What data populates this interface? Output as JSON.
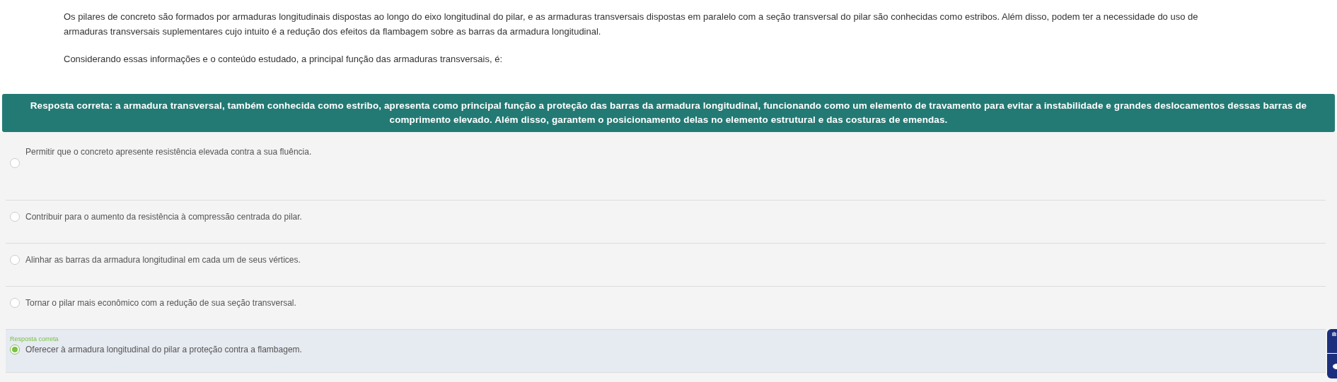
{
  "question": {
    "paragraphs": [
      "Os pilares de concreto são formados por armaduras longitudinais dispostas ao longo do eixo longitudinal do pilar, e as armaduras transversais dispostas em paralelo com a seção transversal do pilar são conhecidas como estribos. Além disso, podem ter a necessidade do uso de armaduras transversais suplementares cujo intuito é a redução dos efeitos da flambagem sobre as barras da armadura longitudinal.",
      "Considerando essas informações e o conteúdo estudado, a principal função das armaduras transversais, é:"
    ]
  },
  "feedback": "Resposta correta: a armadura transversal, também conhecida como estribo, apresenta como principal função a proteção das barras da armadura longitudinal, funcionando como um elemento de travamento para evitar a instabilidade e grandes deslocamentos dessas barras de comprimento elevado. Além disso, garantem o posicionamento delas no elemento estrutural e das costuras de emendas.",
  "options": [
    {
      "text": "Permitir que o concreto apresente resistência elevada contra a sua fluência.",
      "selected": false
    },
    {
      "text": "Contribuir para o aumento da resistência à compressão centrada do pilar.",
      "selected": false
    },
    {
      "text": "Alinhar as barras da armadura longitudinal em cada um de seus vértices.",
      "selected": false
    },
    {
      "text": "Tornar o pilar mais econômico com a redução de sua seção transversal.",
      "selected": false
    },
    {
      "text": "Oferecer à armadura longitudinal do pilar a proteção contra a flambagem.",
      "selected": true,
      "tag": "Resposta correta"
    }
  ]
}
